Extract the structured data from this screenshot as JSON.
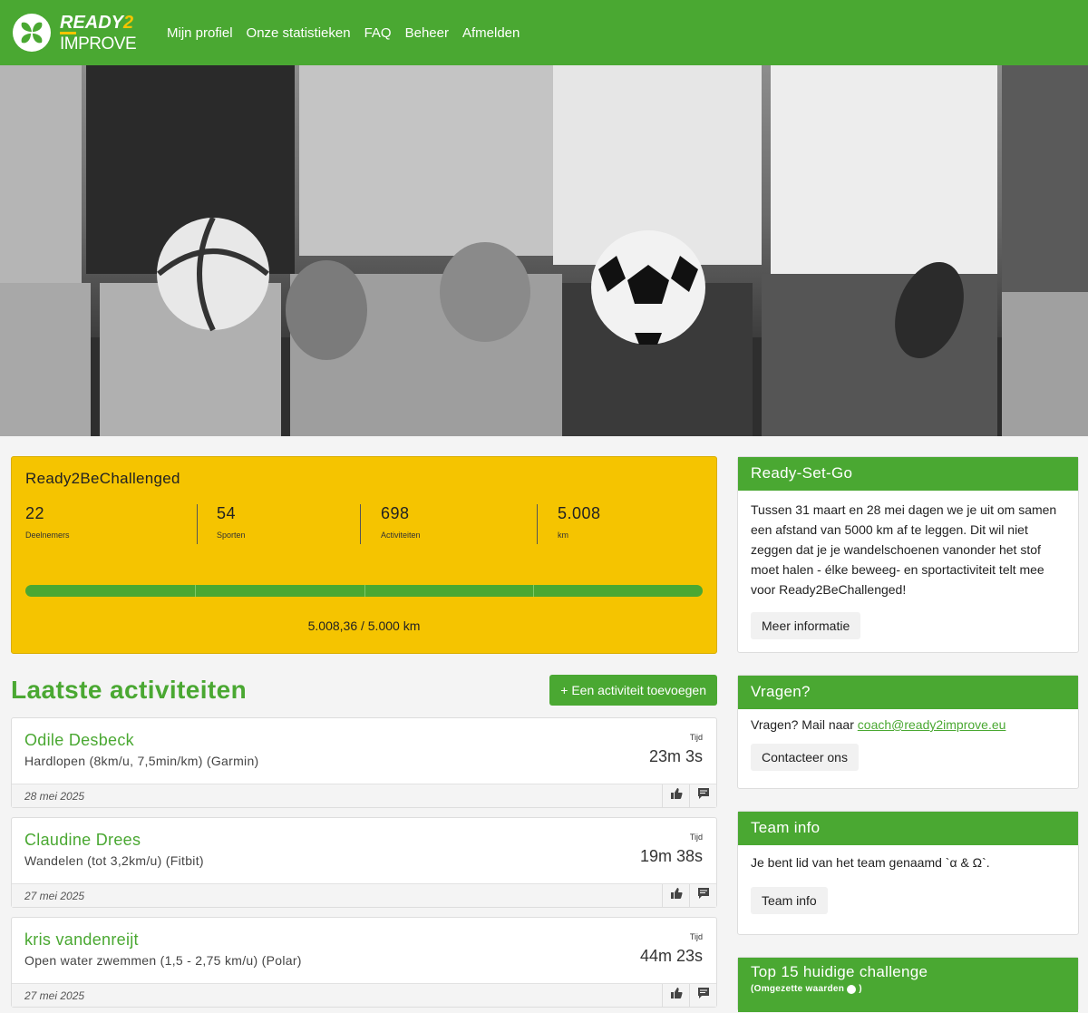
{
  "brand": {
    "line1_a": "READY",
    "line1_b": "2",
    "line2": "IMPROVE"
  },
  "nav": [
    "Mijn profiel",
    "Onze statistieken",
    "FAQ",
    "Beheer",
    "Afmelden"
  ],
  "challenge": {
    "title": "Ready2BeChallenged",
    "stats": [
      {
        "value": "22",
        "label": "Deelnemers"
      },
      {
        "value": "54",
        "label": "Sporten"
      },
      {
        "value": "698",
        "label": "Activiteiten"
      },
      {
        "value": "5.008",
        "label": "km"
      }
    ],
    "progress_fraction": 1.0,
    "progress_label": "5.008,36 / 5.000 km"
  },
  "activities": {
    "heading": "Laatste activiteiten",
    "add_label": "+ Een activiteit toevoegen",
    "items": [
      {
        "name": "Odile Desbeck",
        "desc": "Hardlopen (8km/u, 7,5min/km) (Garmin)",
        "time_label": "Tijd",
        "time": "23m 3s",
        "date": "28 mei 2025"
      },
      {
        "name": "Claudine Drees",
        "desc": "Wandelen (tot 3,2km/u) (Fitbit)",
        "time_label": "Tijd",
        "time": "19m 38s",
        "date": "27 mei 2025"
      },
      {
        "name": "kris vandenreijt",
        "desc": "Open water zwemmen (1,5 - 2,75 km/u) (Polar)",
        "time_label": "Tijd",
        "time": "44m 23s",
        "date": "27 mei 2025"
      }
    ]
  },
  "panels": {
    "rsg": {
      "title": "Ready-Set-Go",
      "text": "Tussen 31 maart en 28 mei dagen we je uit om samen een afstand van 5000 km af te leggen. Dit wil niet zeggen dat je je wandelschoenen vanonder het stof moet halen - élke beweeg- en sportactiviteit telt mee voor Ready2BeChallenged!",
      "button": "Meer informatie"
    },
    "questions": {
      "title": "Vragen?",
      "text": "Vragen? Mail naar ",
      "email": "coach@ready2improve.eu",
      "button": "Contacteer ons"
    },
    "team": {
      "title": "Team info",
      "text": "Je bent lid van het team genaamd `α & Ω`.",
      "button": "Team info"
    },
    "top": {
      "title": "Top 15 huidige challenge",
      "subtitle": "(Omgezette waarden"
    }
  },
  "colors": {
    "green": "#4aa832",
    "yellow": "#f5c400"
  }
}
